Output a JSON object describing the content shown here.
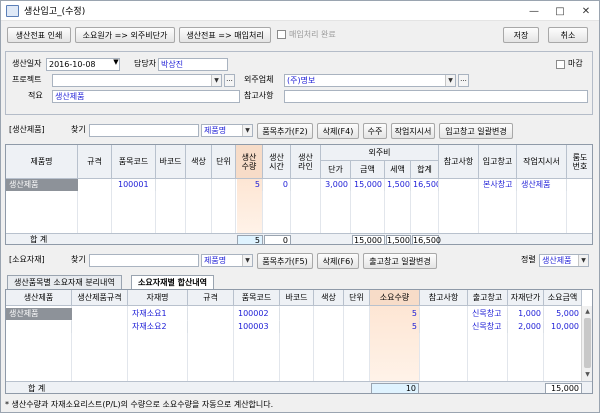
{
  "window": {
    "title": "생산입고_(수정)"
  },
  "toolbar": {
    "print_label": "생산전표 인쇄",
    "outsource_label": "소요원가 => 외주비단가",
    "purchase_label": "생산전표 => 매입처리",
    "purchase_done_label": "매입처리 완료",
    "save_label": "저장",
    "cancel_label": "취소"
  },
  "form": {
    "date_label": "생산일자",
    "date_value": "2016-10-08",
    "manager_label": "담당자",
    "manager_value": "박상진",
    "close_label": "마감",
    "project_label": "프로젝트",
    "project_value": "",
    "vendor_label": "외주업체",
    "vendor_value": "(주)명보",
    "summary_label": "적요",
    "summary_value": "생산제품",
    "note_label": "참고사항",
    "note_value": ""
  },
  "products_section": {
    "title": "[생산제품]",
    "search_label": "찾기",
    "search_mode": "제품명",
    "buttons": [
      "품목추가(F2)",
      "삭제(F4)",
      "수주",
      "작업지시서",
      "입고창고 일괄변경"
    ],
    "headers": {
      "name": "제품명",
      "spec": "규격",
      "code": "품목코드",
      "barcode": "바코드",
      "color": "색상",
      "unit": "단위",
      "qty": "생산\n수량",
      "time": "생산\n시간",
      "line": "생산\n라인",
      "outsource": "외주비",
      "price": "단가",
      "amount": "금액",
      "tax": "세액",
      "total": "합계",
      "note": "참고사항",
      "warehouse": "입고창고",
      "workorder": "작업지시서",
      "order_no": "룸도\n번호"
    },
    "rows": [
      {
        "name": "생산제품",
        "code": "100001",
        "qty": "5",
        "time": "0",
        "price": "3,000",
        "amount": "15,000",
        "tax": "1,500",
        "total": "16,500",
        "warehouse": "본사창고",
        "workorder": "생산제품"
      }
    ],
    "totals": {
      "label": "합  계",
      "qty": "5",
      "time": "0",
      "amount": "15,000",
      "tax": "1,500",
      "total": "16,500"
    }
  },
  "materials_section": {
    "title": "[소요자재]",
    "search_label": "찾기",
    "search_mode": "제품명",
    "buttons": [
      "품목추가(F5)",
      "삭제(F6)",
      "출고창고 일괄변경"
    ],
    "sort_label": "정렬",
    "sort_value": "생산제품",
    "tabs": [
      "생산품목별 소요자재 분리내역",
      "소요자재별 합산내역"
    ],
    "headers": {
      "product": "생산제품",
      "product_spec": "생산제품규격",
      "name": "자재명",
      "spec": "규격",
      "code": "품목코드",
      "barcode": "바코드",
      "color": "색상",
      "unit": "단위",
      "qty": "소요수량",
      "note": "참고사항",
      "warehouse": "출고창고",
      "unit_price": "자재단가",
      "amount": "소요금액"
    },
    "rows": [
      {
        "product": "생산제품",
        "name": "자재소요1",
        "code": "100002",
        "qty": "5",
        "warehouse": "신목창고",
        "unit_price": "1,000",
        "amount": "5,000"
      },
      {
        "product": "",
        "name": "자재소요2",
        "code": "100003",
        "qty": "5",
        "warehouse": "신목창고",
        "unit_price": "2,000",
        "amount": "10,000"
      }
    ],
    "totals": {
      "label": "합  계",
      "qty": "10",
      "amount": "15,000"
    }
  },
  "footer_note": "* 생산수량과 자재소요리스트(P/L)의 수량으로 소요수량을 자동으로 계산합니다."
}
